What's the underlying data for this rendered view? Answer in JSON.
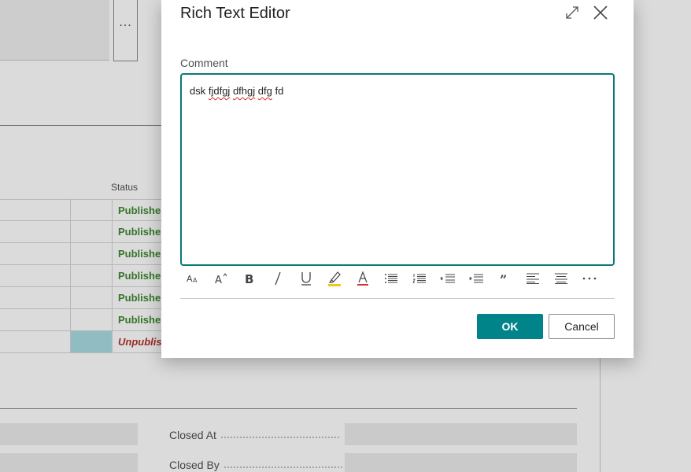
{
  "background": {
    "more_label": "...",
    "status_header": "Status",
    "rows": [
      {
        "status": "Publishe",
        "kind": "published"
      },
      {
        "status": "Publishe",
        "kind": "published"
      },
      {
        "status": "Publishe",
        "kind": "published"
      },
      {
        "status": "Publishe",
        "kind": "published"
      },
      {
        "status": "Publishe",
        "kind": "published"
      },
      {
        "status": "Publishe",
        "kind": "published"
      },
      {
        "status": "Unpublis",
        "kind": "unpublished"
      }
    ],
    "closed_at_label": "Closed At",
    "closed_by_label": "Closed By"
  },
  "dialog": {
    "title": "Rich Text Editor",
    "field_label": "Comment",
    "editor_words": [
      "dsk",
      "fjdfgj",
      "dfhgj",
      "dfg",
      "fd"
    ],
    "ok_label": "OK",
    "cancel_label": "Cancel"
  },
  "toolbar": {
    "icons": [
      "font-size-icon",
      "font-superscript-icon",
      "bold-icon",
      "italic-icon",
      "underline-icon",
      "highlight-icon",
      "font-color-icon",
      "bullet-list-icon",
      "numbered-list-icon",
      "decrease-indent-icon",
      "increase-indent-icon",
      "quote-icon",
      "align-left-icon",
      "align-center-icon",
      "more-options-icon"
    ]
  },
  "colors": {
    "accent": "#008489",
    "editor_border": "#0a7a78",
    "published": "#3f8a2f",
    "unpublished": "#b52f2f",
    "highlight_yellow": "#f2c811",
    "font_color_red": "#d13438",
    "selected_cell": "#a9dde2"
  }
}
